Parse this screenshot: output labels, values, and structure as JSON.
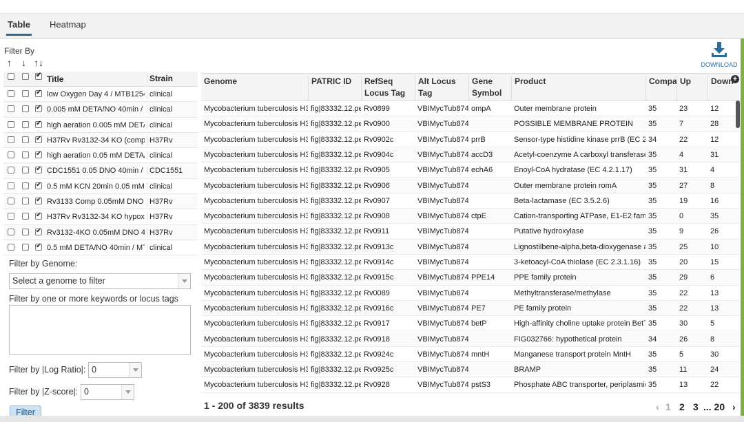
{
  "tabs": [
    {
      "label": "Table",
      "active": true
    },
    {
      "label": "Heatmap",
      "active": false
    }
  ],
  "left_panel": {
    "filter_by": "Filter By",
    "arrows": [
      "↑",
      "↓",
      "↑↓"
    ],
    "columns": {
      "title": "Title",
      "strain": "Strain"
    },
    "rows": [
      {
        "title": "low Oxygen Day 4 / MTB1254",
        "strain": "clinical",
        "up": false,
        "down": false,
        "both": true
      },
      {
        "title": "0.005 mM DETA/NO 40min / I",
        "strain": "clinical",
        "up": false,
        "down": false,
        "both": true
      },
      {
        "title": "high aeration 0.005 mM DETA",
        "strain": "clinical",
        "up": false,
        "down": false,
        "both": true
      },
      {
        "title": "H37Rv Rv3132-34 KO (compl",
        "strain": "H37Rv",
        "up": false,
        "down": false,
        "both": true
      },
      {
        "title": "high aeration 0.05 mM DETA/",
        "strain": "clinical",
        "up": false,
        "down": false,
        "both": true
      },
      {
        "title": "CDC1551 0.05 DNO 40min / (",
        "strain": "CDC1551",
        "up": false,
        "down": false,
        "both": true
      },
      {
        "title": "0.5 mM KCN 20min 0.05 mM",
        "strain": "clinical",
        "up": false,
        "down": false,
        "both": true
      },
      {
        "title": "Rv3133 Comp 0.05mM DNO",
        "strain": "H37Rv",
        "up": false,
        "down": false,
        "both": true
      },
      {
        "title": "H37Rv Rv3132-34 KO hypoxi",
        "strain": "H37Rv",
        "up": false,
        "down": false,
        "both": true
      },
      {
        "title": "Rv3132-4KO 0.05mM DNO 4",
        "strain": "H37Rv",
        "up": false,
        "down": false,
        "both": true
      },
      {
        "title": "0.5 mM DETA/NO 40min / MT",
        "strain": "clinical",
        "up": false,
        "down": false,
        "both": true
      }
    ],
    "genome_label": "Filter by Genome:",
    "genome_placeholder": "Select a genome to filter",
    "keywords_label": "Filter by one or more keywords or locus tags",
    "log_ratio_label": "Filter by |Log Ratio|:",
    "log_ratio_value": "0",
    "zscore_label": "Filter by |Z-score|:",
    "zscore_value": "0",
    "filter_button": "Filter"
  },
  "download_label": "DOWNLOAD",
  "grid": {
    "headers": [
      [
        "Genome",
        ""
      ],
      [
        "PATRIC ID",
        ""
      ],
      [
        "RefSeq",
        "Locus Tag"
      ],
      [
        "Alt Locus",
        "Tag"
      ],
      [
        "Gene",
        "Symbol"
      ],
      [
        "Product",
        ""
      ],
      [
        "Compa",
        ""
      ],
      [
        "Up",
        ""
      ],
      [
        "Down",
        ""
      ]
    ],
    "rows": [
      [
        "Mycobacterium tuberculosis H37",
        "fig|83332.12.pe",
        "Rv0899",
        "VBIMycTub874",
        "ompA",
        "Outer membrane protein",
        "35",
        "23",
        "12"
      ],
      [
        "Mycobacterium tuberculosis H37",
        "fig|83332.12.pe",
        "Rv0900",
        "VBIMycTub874",
        "",
        "POSSIBLE MEMBRANE PROTEIN",
        "35",
        "7",
        "28"
      ],
      [
        "Mycobacterium tuberculosis H37",
        "fig|83332.12.pe",
        "Rv0902c",
        "VBIMycTub874",
        "prrB",
        "Sensor-type histidine kinase prrB (EC 2.",
        "34",
        "22",
        "12"
      ],
      [
        "Mycobacterium tuberculosis H37",
        "fig|83332.12.pe",
        "Rv0904c",
        "VBIMycTub874",
        "accD3",
        "Acetyl-coenzyme A carboxyl transferase",
        "35",
        "4",
        "31"
      ],
      [
        "Mycobacterium tuberculosis H37",
        "fig|83332.12.pe",
        "Rv0905",
        "VBIMycTub874",
        "echA6",
        "Enoyl-CoA hydratase (EC 4.2.1.17)",
        "35",
        "31",
        "4"
      ],
      [
        "Mycobacterium tuberculosis H37",
        "fig|83332.12.pe",
        "Rv0906",
        "VBIMycTub874",
        "",
        "Outer membrane protein romA",
        "35",
        "27",
        "8"
      ],
      [
        "Mycobacterium tuberculosis H37",
        "fig|83332.12.pe",
        "Rv0907",
        "VBIMycTub874",
        "",
        "Beta-lactamase (EC 3.5.2.6)",
        "35",
        "19",
        "16"
      ],
      [
        "Mycobacterium tuberculosis H37",
        "fig|83332.12.pe",
        "Rv0908",
        "VBIMycTub874",
        "ctpE",
        "Cation-transporting ATPase, E1-E2 famil",
        "35",
        "0",
        "35"
      ],
      [
        "Mycobacterium tuberculosis H37",
        "fig|83332.12.pe",
        "Rv0911",
        "VBIMycTub874",
        "",
        "Putative hydroxylase",
        "35",
        "9",
        "26"
      ],
      [
        "Mycobacterium tuberculosis H37",
        "fig|83332.12.pe",
        "Rv0913c",
        "VBIMycTub874",
        "",
        "Lignostilbene-alpha,beta-dioxygenase ar",
        "35",
        "25",
        "10"
      ],
      [
        "Mycobacterium tuberculosis H37",
        "fig|83332.12.pe",
        "Rv0914c",
        "VBIMycTub874",
        "",
        "3-ketoacyl-CoA thiolase (EC 2.3.1.16)",
        "35",
        "20",
        "15"
      ],
      [
        "Mycobacterium tuberculosis H37",
        "fig|83332.12.pe",
        "Rv0915c",
        "VBIMycTub874",
        "PPE14",
        "PPE family protein",
        "35",
        "29",
        "6"
      ],
      [
        "Mycobacterium tuberculosis H37",
        "fig|83332.12.pe",
        "Rv0089",
        "VBIMycTub874",
        "",
        "Methyltransferase/methylase",
        "35",
        "22",
        "13"
      ],
      [
        "Mycobacterium tuberculosis H37",
        "fig|83332.12.pe",
        "Rv0916c",
        "VBIMycTub874",
        "PE7",
        "PE family protein",
        "35",
        "22",
        "13"
      ],
      [
        "Mycobacterium tuberculosis H37",
        "fig|83332.12.pe",
        "Rv0917",
        "VBIMycTub874",
        "betP",
        "High-affinity choline uptake protein BetT",
        "35",
        "30",
        "5"
      ],
      [
        "Mycobacterium tuberculosis H37",
        "fig|83332.12.pe",
        "Rv0918",
        "VBIMycTub874",
        "",
        "FIG032766: hypothetical protein",
        "34",
        "26",
        "8"
      ],
      [
        "Mycobacterium tuberculosis H37",
        "fig|83332.12.pe",
        "Rv0924c",
        "VBIMycTub874",
        "mntH",
        "Manganese transport protein MntH",
        "35",
        "5",
        "30"
      ],
      [
        "Mycobacterium tuberculosis H37",
        "fig|83332.12.pe",
        "Rv0925c",
        "VBIMycTub874",
        "",
        "BRAMP",
        "35",
        "11",
        "24"
      ],
      [
        "Mycobacterium tuberculosis H37",
        "fig|83332.12.pe",
        "Rv0928",
        "VBIMycTub874",
        "pstS3",
        "Phosphate ABC transporter, periplasmic",
        "35",
        "13",
        "22"
      ]
    ]
  },
  "results_text": "1 - 200 of 3839 results",
  "pager": {
    "prev": "‹",
    "pages": [
      "1",
      "2",
      "3"
    ],
    "ellipsis": "... 20",
    "next": "›"
  }
}
